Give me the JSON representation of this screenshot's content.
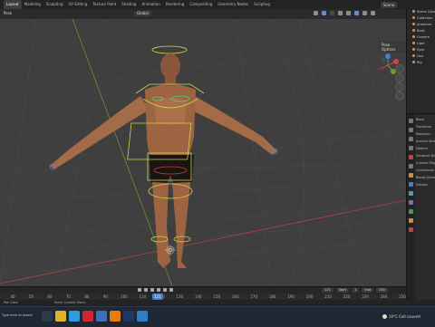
{
  "workspace_tabs": [
    "Layout",
    "Modeling",
    "Sculpting",
    "UV Editing",
    "Texture Paint",
    "Shading",
    "Animation",
    "Rendering",
    "Compositing",
    "Geometry Nodes",
    "Scripting"
  ],
  "active_tab": "Layout",
  "scene": {
    "label": "Scene",
    "extra": "View Layer"
  },
  "viewport": {
    "mode": "Pose",
    "orientation": "Global",
    "projection_options": "Pose Options",
    "gizmo": {
      "x": "X",
      "y": "Y",
      "z": "Z"
    }
  },
  "outliner": {
    "title": "Scene Collection",
    "rows": [
      "Scene Collection",
      "Collection",
      "Armature",
      "Body",
      "Camera",
      "Light",
      "Eyes",
      "Hair",
      "Rig"
    ]
  },
  "properties": {
    "rows": [
      "Bone",
      "Transform",
      "Relations",
      "Inverse Kinematics",
      "Deform",
      "Viewport Display",
      "Custom Props",
      "Constraints",
      "Bendy Bones",
      "Display"
    ]
  },
  "timeline": {
    "ticks": [
      "40",
      "50",
      "60",
      "70",
      "80",
      "90",
      "100",
      "110",
      "120",
      "130",
      "140",
      "150",
      "160",
      "170",
      "180",
      "190",
      "200",
      "210",
      "220",
      "230",
      "240",
      "250"
    ],
    "current_frame": "121",
    "start_label": "Start",
    "start_value": "1",
    "end_label": "End",
    "end_value": "250"
  },
  "status": {
    "left": "Pan View",
    "middle": "Bone Context Menu"
  },
  "taskbar": {
    "search": "Type here to search",
    "apps": [
      {
        "name": "task-view",
        "color": "#2c3a4a"
      },
      {
        "name": "file-explorer",
        "color": "#e0b12c"
      },
      {
        "name": "edge",
        "color": "#2f9be0"
      },
      {
        "name": "opera",
        "color": "#d0262f"
      },
      {
        "name": "store",
        "color": "#3e6fb5"
      },
      {
        "name": "blender",
        "color": "#e87d0d"
      },
      {
        "name": "photoshop",
        "color": "#1d3a66"
      },
      {
        "name": "photos",
        "color": "#2f7fc8"
      }
    ],
    "weather": "19°C  Cell couvert"
  }
}
